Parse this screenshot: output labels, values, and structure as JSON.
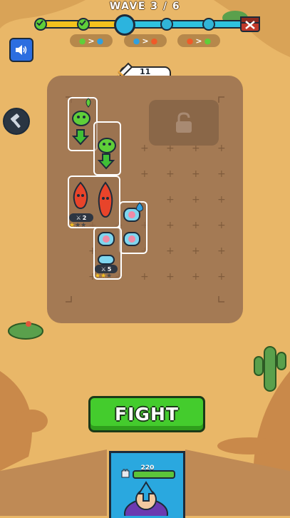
{
  "header": {
    "wave_label": "WAVE 3 / 6"
  },
  "wave_progress": {
    "current_wave": 3,
    "total_waves": 6
  },
  "matchups": [
    {
      "from": "leaf-icon",
      "to": "water-icon",
      "separator": ">"
    },
    {
      "from": "water-icon",
      "to": "fire-icon",
      "separator": ">"
    },
    {
      "from": "fire-icon",
      "to": "leaf-icon",
      "separator": ">"
    }
  ],
  "resources": {
    "swords": "11"
  },
  "units": [
    {
      "id": "leaf-chain",
      "element": "leaf",
      "level_badge": "",
      "stars": 0
    },
    {
      "id": "fire-pair",
      "element": "fire",
      "level_badge": "2",
      "stars": 1
    },
    {
      "id": "water-chain",
      "element": "water",
      "level_badge": "5",
      "stars": 2
    }
  ],
  "buttons": {
    "fight": "FIGHT"
  },
  "hero": {
    "hp": "220"
  },
  "colors": {
    "accent": "#44cc2d",
    "track_done": "#f4c21d",
    "track_left": "#2fc3df",
    "board": "#a47a54"
  }
}
